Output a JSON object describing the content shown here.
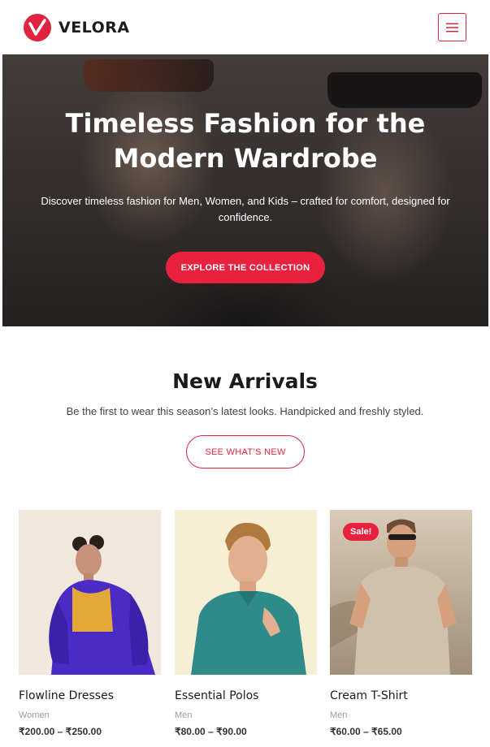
{
  "header": {
    "brand_name": "VELORA",
    "menu_icon": "hamburger-menu-icon",
    "accent_color": "#e0243e"
  },
  "hero": {
    "title": "Timeless Fashion for the Modern Wardrobe",
    "subtitle": "Discover timeless fashion for Men, Women, and Kids – crafted for comfort, designed for confidence.",
    "cta_label": "EXPLORE THE COLLECTION"
  },
  "new_arrivals": {
    "title": "New Arrivals",
    "subtitle": "Be the first to wear this season’s latest looks. Handpicked and freshly styled.",
    "button_label": "SEE WHAT’S NEW"
  },
  "products": [
    {
      "name": "Flowline Dresses",
      "category": "Women",
      "price": "₹200.00 – ₹250.00",
      "badge": ""
    },
    {
      "name": "Essential Polos",
      "category": "Men",
      "price": "₹80.00 – ₹90.00",
      "badge": ""
    },
    {
      "name": "Cream T-Shirt",
      "category": "Men",
      "price": "₹60.00 – ₹65.00",
      "badge": "Sale!"
    }
  ]
}
